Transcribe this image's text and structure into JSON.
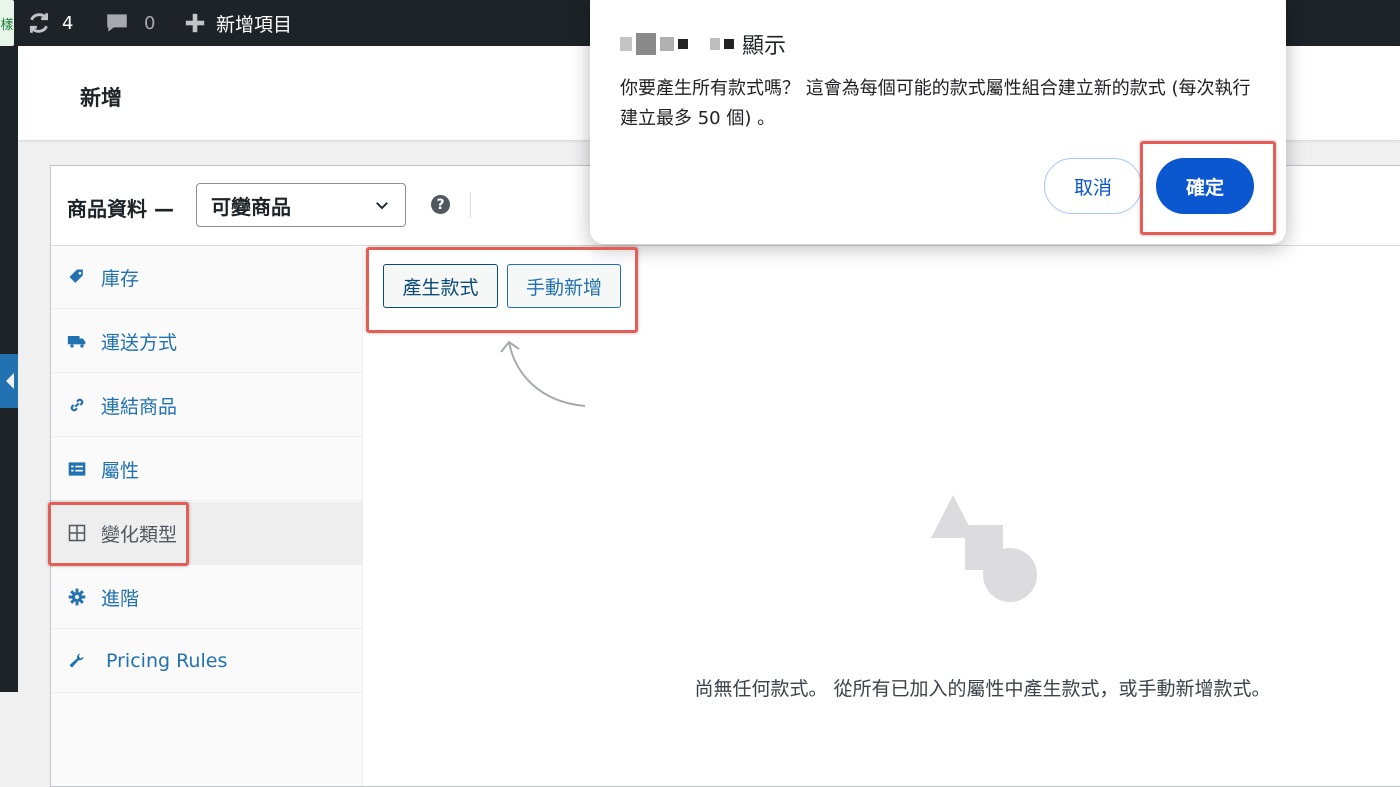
{
  "admin_bar": {
    "site_char": "樣",
    "updates_count": "4",
    "comments_count": "0",
    "new_item_label": "新增項目"
  },
  "page": {
    "title": "新增"
  },
  "product_data": {
    "title": "商品資料 —",
    "product_type": "可變商品",
    "help_glyph": "?"
  },
  "tabs": [
    {
      "label": "庫存",
      "icon": "tag-icon"
    },
    {
      "label": "運送方式",
      "icon": "truck-icon"
    },
    {
      "label": "連結商品",
      "icon": "link-icon"
    },
    {
      "label": "屬性",
      "icon": "list-icon"
    },
    {
      "label": "變化類型",
      "icon": "grid-icon",
      "active": true
    },
    {
      "label": "進階",
      "icon": "gear-icon"
    },
    {
      "label": "Pricing Rules",
      "icon": "wrench-icon"
    }
  ],
  "variations": {
    "generate_label": "產生款式",
    "manual_label": "手動新增",
    "empty_message": "尚無任何款式。 從所有已加入的屬性中產生款式，或手動新增款式。"
  },
  "dialog": {
    "title_suffix": "顯示",
    "message": "你要產生所有款式嗎？ 這會為每個可能的款式屬性組合建立新的款式 (每次執行建立最多 50 個) 。",
    "cancel_label": "取消",
    "ok_label": "確定"
  },
  "colors": {
    "admin_bar": "#1d2327",
    "link_blue": "#2271b1",
    "dialog_primary": "#0b57d0",
    "annotation_red": "#e45e55"
  }
}
